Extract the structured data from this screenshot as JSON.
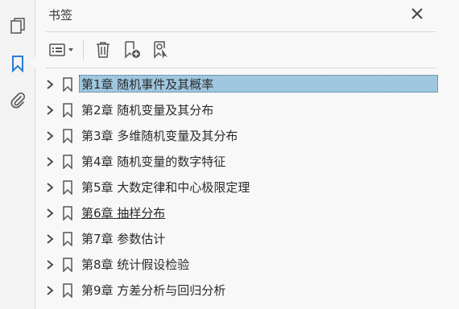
{
  "panel": {
    "title": "书签"
  },
  "rail": {
    "items": [
      "pages-icon",
      "bookmark-icon",
      "attachment-icon"
    ]
  },
  "toolbar": {
    "items": [
      "options-icon",
      "delete-icon",
      "new-bookmark-icon",
      "new-bookmark-from-structure-icon"
    ]
  },
  "bookmarks": [
    {
      "label": "第1章  随机事件及其概率"
    },
    {
      "label": "第2章  随机变量及其分布"
    },
    {
      "label": "第3章  多维随机变量及其分布"
    },
    {
      "label": "第4章  随机变量的数字特征"
    },
    {
      "label": "第5章  大数定律和中心极限定理"
    },
    {
      "label": "第6章  抽样分布"
    },
    {
      "label": "第7章  参数估计"
    },
    {
      "label": "第8章  统计假设检验"
    },
    {
      "label": "第9章  方差分析与回归分析"
    }
  ],
  "selected_index": 0,
  "hovered_index": 5,
  "colors": {
    "selection": "#9fc7df",
    "active_icon": "#2a7bd4"
  }
}
